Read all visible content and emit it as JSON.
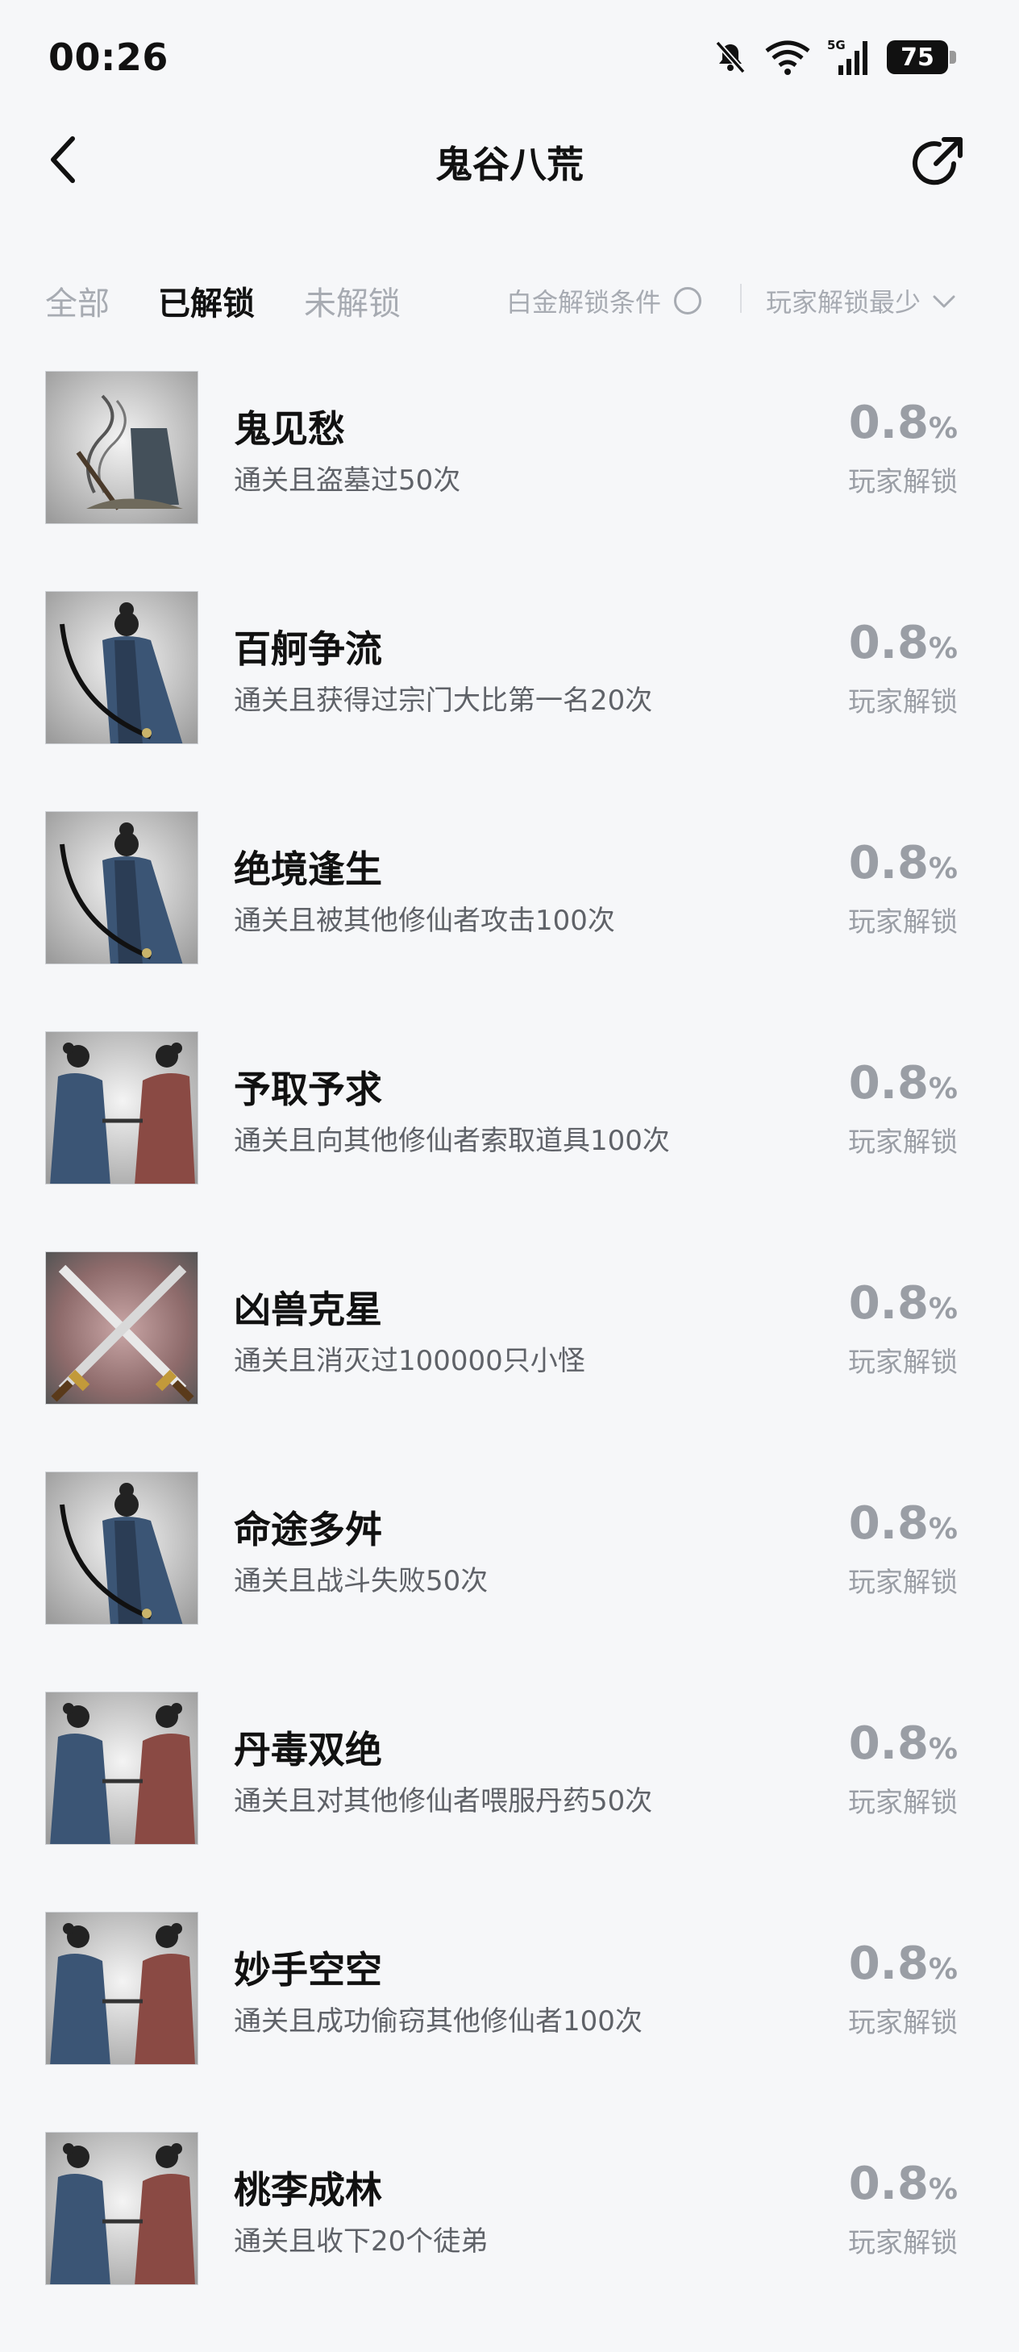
{
  "status": {
    "time": "00:26",
    "network": "5G",
    "battery": "75"
  },
  "header": {
    "title": "鬼谷八荒"
  },
  "filters": {
    "tabs": [
      {
        "label": "全部",
        "active": false
      },
      {
        "label": "已解锁",
        "active": true
      },
      {
        "label": "未解锁",
        "active": false
      }
    ],
    "platinum_label": "白金解锁条件",
    "sort_label": "玩家解锁最少"
  },
  "achievements": [
    {
      "title": "鬼见愁",
      "desc": "通关且盗墓过50次",
      "percent": "0.8",
      "unit": "%",
      "label": "玩家解锁",
      "icon": "grave-incense-icon"
    },
    {
      "title": "百舸争流",
      "desc": "通关且获得过宗门大比第一名20次",
      "percent": "0.8",
      "unit": "%",
      "label": "玩家解锁",
      "icon": "swordsman-icon"
    },
    {
      "title": "绝境逢生",
      "desc": "通关且被其他修仙者攻击100次",
      "percent": "0.8",
      "unit": "%",
      "label": "玩家解锁",
      "icon": "swordsman-icon"
    },
    {
      "title": "予取予求",
      "desc": "通关且向其他修仙者索取道具100次",
      "percent": "0.8",
      "unit": "%",
      "label": "玩家解锁",
      "icon": "two-cultivators-icon"
    },
    {
      "title": "凶兽克星",
      "desc": "通关且消灭过100000只小怪",
      "percent": "0.8",
      "unit": "%",
      "label": "玩家解锁",
      "icon": "crossed-swords-icon"
    },
    {
      "title": "命途多舛",
      "desc": "通关且战斗失败50次",
      "percent": "0.8",
      "unit": "%",
      "label": "玩家解锁",
      "icon": "swordsman-icon"
    },
    {
      "title": "丹毒双绝",
      "desc": "通关且对其他修仙者喂服丹药50次",
      "percent": "0.8",
      "unit": "%",
      "label": "玩家解锁",
      "icon": "two-cultivators-icon"
    },
    {
      "title": "妙手空空",
      "desc": "通关且成功偷窃其他修仙者100次",
      "percent": "0.8",
      "unit": "%",
      "label": "玩家解锁",
      "icon": "two-cultivators-icon"
    },
    {
      "title": "桃李成林",
      "desc": "通关且收下20个徒弟",
      "percent": "0.8",
      "unit": "%",
      "label": "玩家解锁",
      "icon": "two-cultivators-icon"
    }
  ]
}
